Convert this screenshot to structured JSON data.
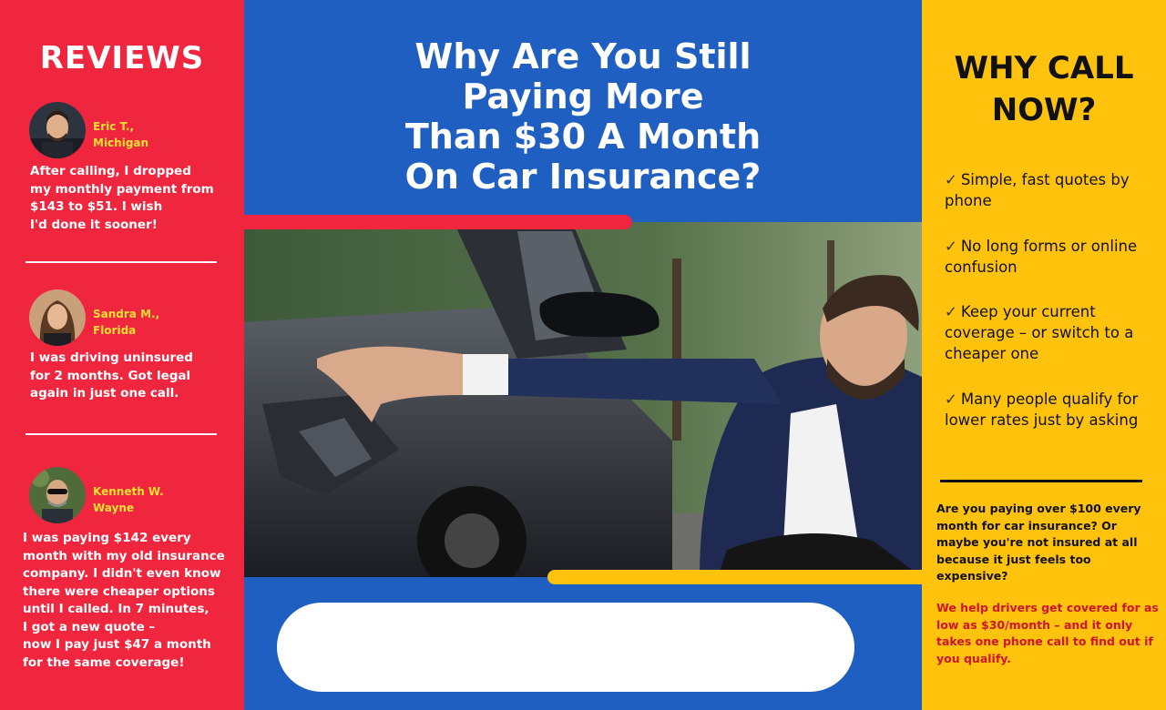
{
  "reviews": {
    "title": "REVIEWS",
    "items": [
      {
        "name": "Eric T.,\nMichigan",
        "text": "After calling, I dropped\nmy monthly payment from\n$143 to $51. I wish\nI'd done it sooner!",
        "avatar_icon": "avatar-man-beard"
      },
      {
        "name": "Sandra M.,\nFlorida",
        "text": "I was driving uninsured\nfor 2 months. Got legal\nagain in just one call.",
        "avatar_icon": "avatar-woman"
      },
      {
        "name": "Kenneth W.\nWayne",
        "text": "I was paying $142 every\nmonth with my old insurance\ncompany. I didn't even know\nthere were cheaper options\nuntil I called. In 7 minutes,\nI got a new quote –\nnow I pay just $47 a month\nfor the same coverage!",
        "avatar_icon": "avatar-man-sunglasses"
      }
    ]
  },
  "main": {
    "headline": "Why Are You Still\nPaying More\nThan $30 A Month\nOn Car Insurance?",
    "photo_icon": "damaged-car-photo"
  },
  "why": {
    "title": "WHY CALL\nNOW?",
    "check_glyph": "✓",
    "bullets": [
      "Simple, fast quotes by phone",
      "No long forms or online confusion",
      "Keep your current coverage – or switch to a cheaper one",
      "Many people qualify for lower rates just by asking"
    ],
    "question": "Are you paying over $100 every month for car insurance? Or maybe you're not insured at all because it just feels too expensive?",
    "help": "We help drivers get covered for as low as $30/month – and it only takes one phone call to find out if you qualify."
  },
  "colors": {
    "red": "#f0263f",
    "blue": "#1f5fc2",
    "yellow": "#ffc20d",
    "name_yellow": "#ffe033",
    "help_red": "#d0152a"
  }
}
